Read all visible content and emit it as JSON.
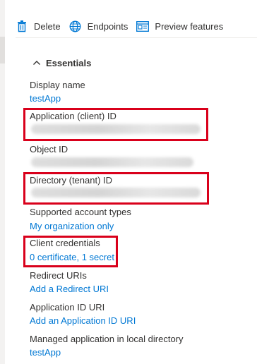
{
  "toolbar": {
    "delete_label": "Delete",
    "endpoints_label": "Endpoints",
    "preview_label": "Preview features",
    "accent": "#0078d4"
  },
  "essentials": {
    "label": "Essentials"
  },
  "fields": {
    "display_name": {
      "label": "Display name",
      "value": "testApp"
    },
    "app_id": {
      "label": "Application (client) ID"
    },
    "object_id": {
      "label": "Object ID"
    },
    "tenant_id": {
      "label": "Directory (tenant) ID"
    },
    "account_types": {
      "label": "Supported account types",
      "value": "My organization only"
    },
    "credentials": {
      "label": "Client credentials",
      "value": "0 certificate, 1 secret"
    },
    "redirect": {
      "label": "Redirect URIs",
      "value": "Add a Redirect URI"
    },
    "app_id_uri": {
      "label": "Application ID URI",
      "value": "Add an Application ID URI"
    },
    "managed_app": {
      "label": "Managed application in local directory",
      "value": "testApp"
    }
  },
  "highlight_color": "#d9001b"
}
